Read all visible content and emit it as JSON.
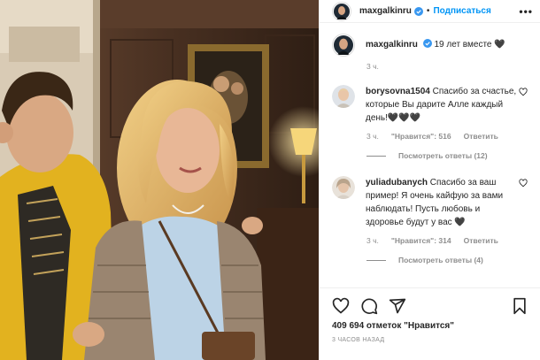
{
  "header": {
    "username": "maxgalkinru",
    "follow_label": "Подписаться",
    "dot": "•",
    "more_label": "•••"
  },
  "caption": {
    "username": "maxgalkinru",
    "text": "19 лет вместе 🖤",
    "time": "3 ч."
  },
  "comments": [
    {
      "username": "borysovna1504",
      "text": "Спасибо за счастье, которые Вы дарите Алле каждый день!🖤🖤🖤",
      "time": "3 ч.",
      "likes": "\"Нравится\": 516",
      "reply_label": "Ответить",
      "view_replies": "Посмотреть ответы (12)"
    },
    {
      "username": "yuliadubanych",
      "text": "Спасибо за ваш пример! Я очень кайфую за вами наблюдать! Пусть любовь и здоровье будут у вас 🖤",
      "time": "3 ч.",
      "likes": "\"Нравится\": 314",
      "reply_label": "Ответить",
      "view_replies": "Посмотреть ответы (4)"
    }
  ],
  "footer": {
    "likes_text": "409 694 отметок \"Нравится\"",
    "posted_ago": "3 часов назад"
  },
  "icons": {
    "heart": "heart-icon",
    "comment": "comment-icon",
    "share": "share-icon",
    "save": "bookmark-icon",
    "verified": "verified-badge-icon"
  },
  "colors": {
    "accent": "#0095f6",
    "text": "#262626",
    "muted": "#8e8e8e",
    "border": "#efefef"
  }
}
